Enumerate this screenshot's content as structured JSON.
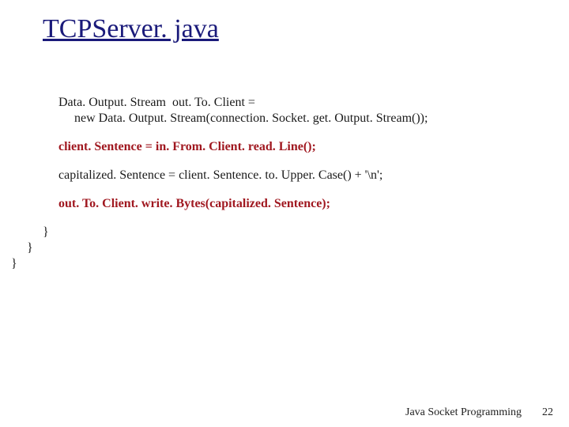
{
  "title": "TCPServer. java",
  "code": {
    "l1": "Data. Output. Stream  out. To. Client =",
    "l2": "     new Data. Output. Stream(connection. Socket. get. Output. Stream());",
    "l3": "client. Sentence = in. From. Client. read. Line();",
    "l4": "capitalized. Sentence = client. Sentence. to. Upper. Case() + '\\n';",
    "l5": "out. To. Client. write. Bytes(capitalized. Sentence);",
    "b3": "}",
    "b2": "}",
    "b1": "}"
  },
  "footer": "Java Socket Programming",
  "page": "22"
}
